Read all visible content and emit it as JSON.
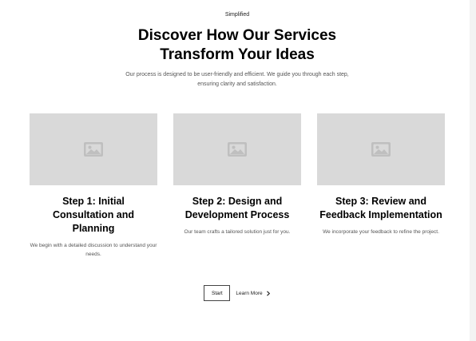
{
  "header": {
    "tagline": "Simplified",
    "title_line1": "Discover How Our Services",
    "title_line2": "Transform Your Ideas",
    "subtitle_line1": "Our process is designed to be user-friendly and efficient. We guide you through each step,",
    "subtitle_line2": "ensuring clarity and satisfaction."
  },
  "steps": [
    {
      "title_line1": "Step 1: Initial",
      "title_line2": "Consultation and",
      "title_line3": "Planning",
      "desc_line1": "We begin with a detailed discussion to understand your",
      "desc_line2": "needs.",
      "image_icon": "image-placeholder-icon"
    },
    {
      "title_line1": "Step 2: Design and",
      "title_line2": "Development Process",
      "desc_line1": "Our team crafts a tailored solution just for you.",
      "image_icon": "image-placeholder-icon"
    },
    {
      "title_line1": "Step 3: Review and",
      "title_line2": "Feedback Implementation",
      "desc_line1": "We incorporate your feedback to refine the project.",
      "image_icon": "image-placeholder-icon"
    }
  ],
  "actions": {
    "start_label": "Start",
    "learn_more_label": "Learn More",
    "learn_more_icon": "chevron-right-icon"
  },
  "colors": {
    "placeholder_bg": "#d9d9d9",
    "placeholder_icon": "#bfbfbf"
  }
}
